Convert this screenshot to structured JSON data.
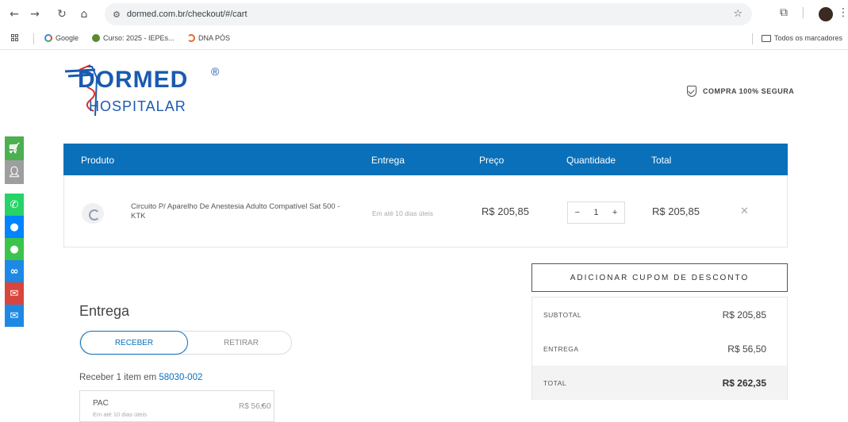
{
  "browser": {
    "url": "dormed.com.br/checkout/#/cart",
    "bookmarks": [
      {
        "label": "Google",
        "icon": "google-icon"
      },
      {
        "label": "Curso: 2025 - IEPEs...",
        "icon": "globe-icon"
      },
      {
        "label": "DNA PÓS",
        "icon": "dna-icon"
      }
    ],
    "all_bookmarks_label": "Todos os marcadores"
  },
  "header": {
    "logo_text": "DORMED",
    "logo_reg": "®",
    "logo_sub": "HOSPITALAR",
    "secure_label": "COMPRA 100% SEGURA"
  },
  "side_buttons": [
    {
      "icon": "cart-icon",
      "color": "#4caf50"
    },
    {
      "icon": "add-user-icon",
      "color": "#9e9e9e"
    },
    {
      "icon": "whatsapp-icon",
      "color": "#25d366"
    },
    {
      "icon": "messenger-icon",
      "color": "#0084ff"
    },
    {
      "icon": "chat-icon",
      "color": "#3bc44b"
    },
    {
      "icon": "link-icon",
      "color": "#1e88e5"
    },
    {
      "icon": "gmail-icon",
      "color": "#d9453c"
    },
    {
      "icon": "email-icon",
      "color": "#1e88e5"
    }
  ],
  "cart": {
    "columns": [
      "Produto",
      "Entrega",
      "Preço",
      "Quantidade",
      "Total"
    ],
    "items": [
      {
        "name": "Circuito P/ Aparelho De Anestesia Adulto Compatível Sat 500 - KTK",
        "delivery": "Em até 10 dias úteis",
        "price": "R$ 205,85",
        "quantity": "1",
        "total": "R$ 205,85"
      }
    ]
  },
  "coupon_label": "ADICIONAR CUPOM DE DESCONTO",
  "summary": {
    "subtotal_label": "SUBTOTAL",
    "subtotal_value": "R$ 205,85",
    "shipping_label": "ENTREGA",
    "shipping_value": "R$ 56,50",
    "total_label": "TOTAL",
    "total_value": "R$ 262,35"
  },
  "delivery": {
    "title": "Entrega",
    "receive_label": "RECEBER",
    "pickup_label": "RETIRAR",
    "receive_text": "Receber 1 item em",
    "cep": "58030-002",
    "option_name": "PAC",
    "option_time": "Em até 10 dias úteis",
    "option_price": "R$ 56,50"
  },
  "colors": {
    "primary": "#0a70b9",
    "logo": "#1a5bb0"
  }
}
